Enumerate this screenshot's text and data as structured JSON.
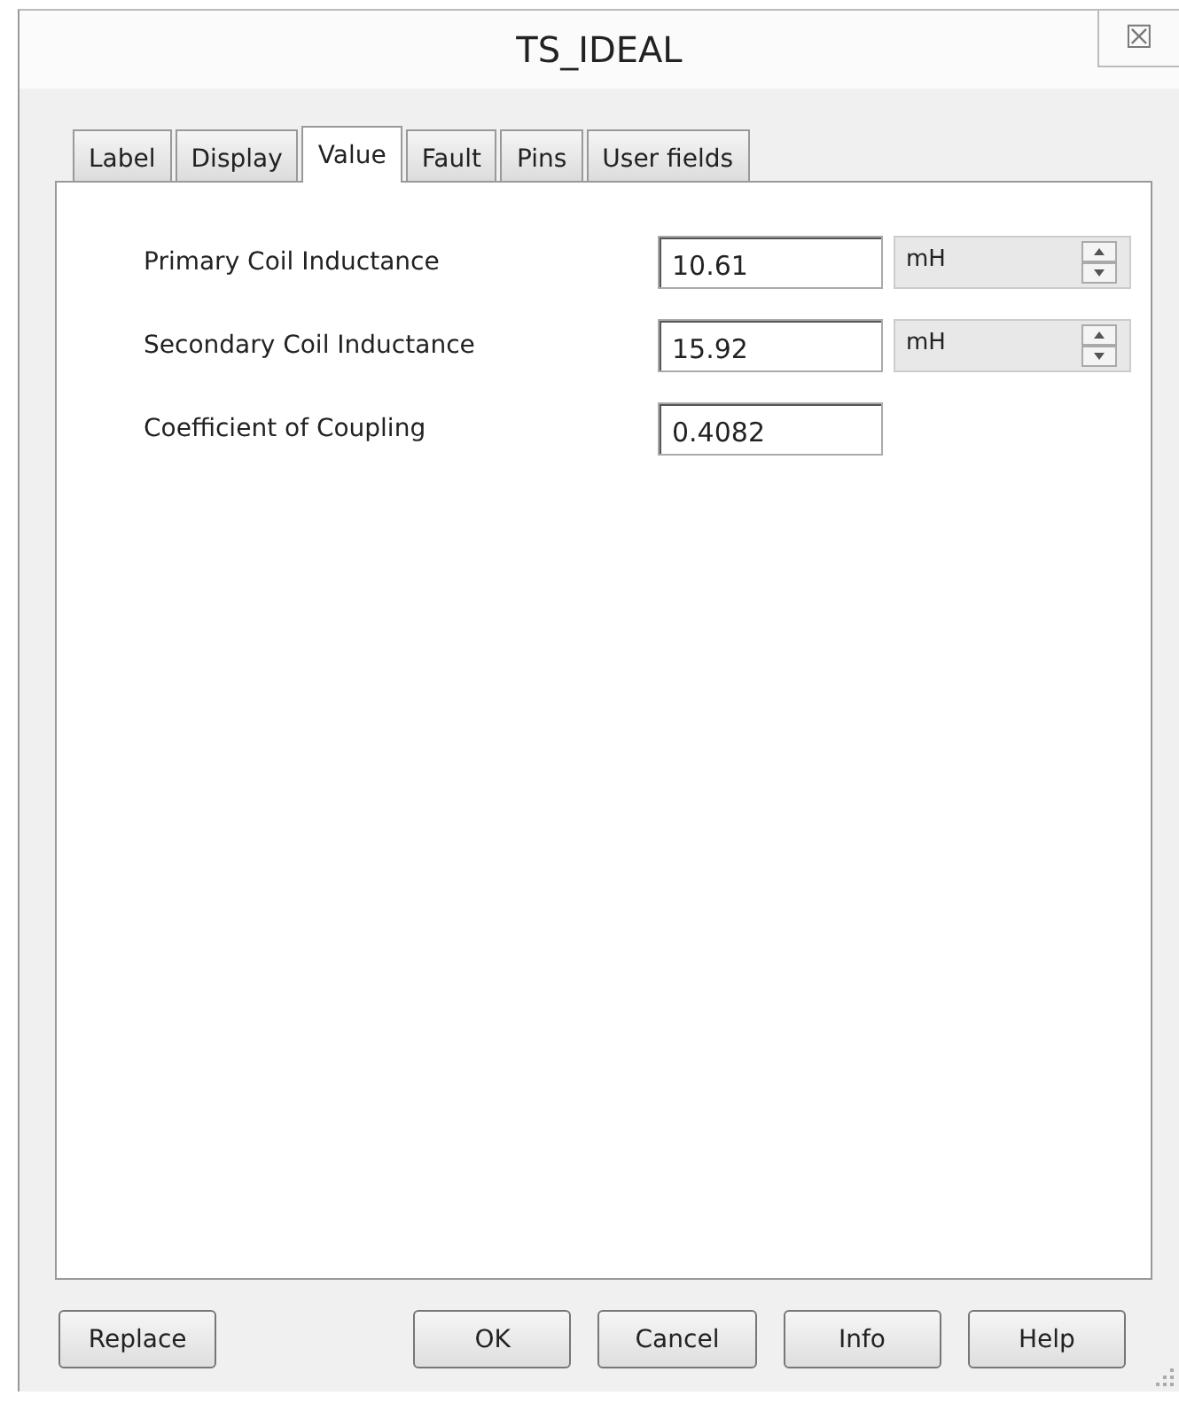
{
  "window": {
    "title": "TS_IDEAL",
    "close_icon": "☒"
  },
  "tabs": [
    {
      "label": "Label",
      "selected": false
    },
    {
      "label": "Display",
      "selected": false
    },
    {
      "label": "Value",
      "selected": true
    },
    {
      "label": "Fault",
      "selected": false
    },
    {
      "label": "Pins",
      "selected": false
    },
    {
      "label": "User fields",
      "selected": false
    }
  ],
  "parameters": [
    {
      "label": "Primary Coil Inductance",
      "value": "10.61",
      "unit": "mH"
    },
    {
      "label": "Secondary Coil Inductance",
      "value": "15.92",
      "unit": "mH"
    },
    {
      "label": "Coefficient of Coupling",
      "value": "0.4082"
    }
  ],
  "buttons": [
    {
      "label": "Replace"
    },
    {
      "label": "OK"
    },
    {
      "label": "Cancel"
    },
    {
      "label": "Info"
    },
    {
      "label": "Help"
    }
  ]
}
